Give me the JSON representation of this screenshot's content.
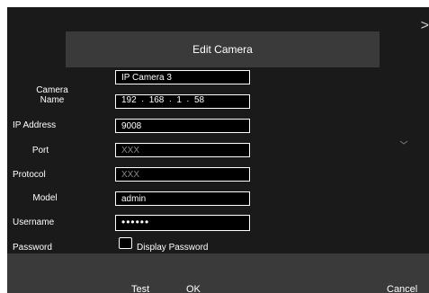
{
  "dialog": {
    "title": "Edit Camera",
    "close_glyph": ">"
  },
  "labels": {
    "camera_name": "Camera\nName",
    "camera_name_line1": "Camera",
    "camera_name_line2": "Name",
    "ip_address": "IP Address",
    "port": "Port",
    "protocol": "Protocol",
    "model": "Model",
    "username": "Username",
    "password": "Password"
  },
  "fields": {
    "camera_name": "IP Camera 3",
    "ip_octets": [
      "192",
      "168",
      "1",
      "58"
    ],
    "ip_separator": ".",
    "port": "9008",
    "protocol": "XXX",
    "model": "XXX",
    "username": "admin",
    "password_mask": "••••••"
  },
  "checkbox": {
    "label": "Display Password",
    "checked": false
  },
  "buttons": {
    "test": "Test",
    "ok": "OK",
    "cancel": "Cancel"
  },
  "icons": {
    "close": "close-icon",
    "chevron": "chevron-down-icon"
  },
  "colors": {
    "background": "#1a1a1a",
    "title_bar": "#3a3a3a",
    "footer": "#3a3a3a",
    "text": "#ffffff",
    "field_border": "#ffffff"
  }
}
